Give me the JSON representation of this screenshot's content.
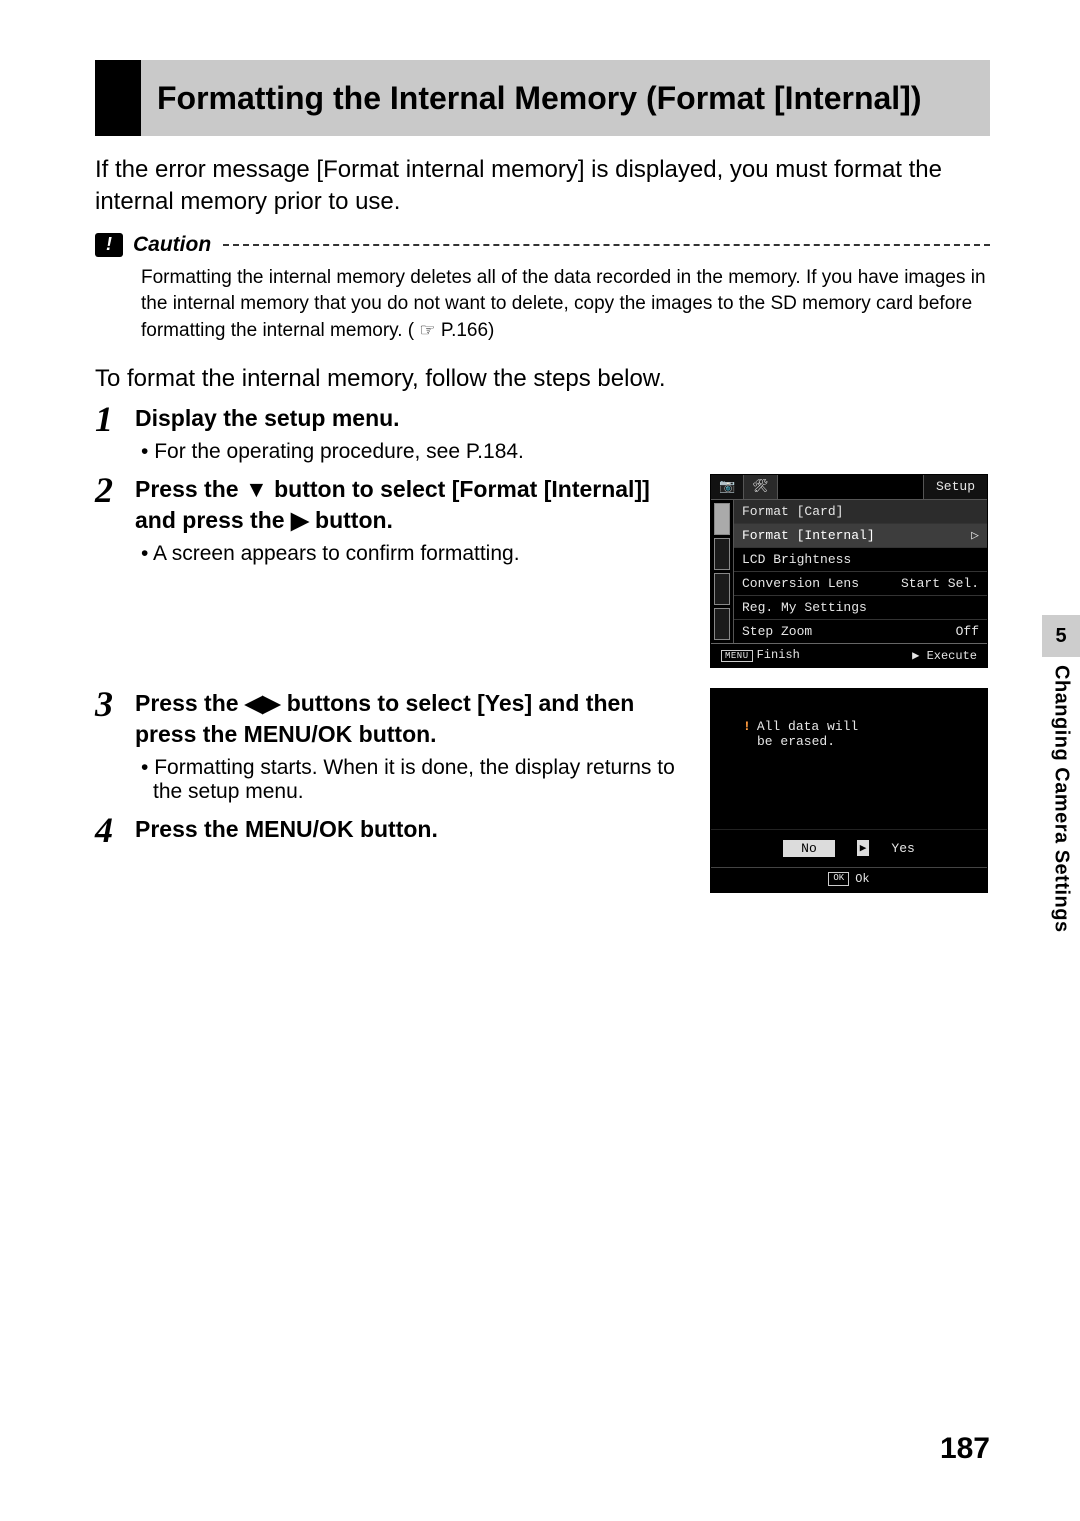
{
  "title": "Formatting the Internal Memory (Format [Internal])",
  "intro": "If the error message [Format internal memory] is displayed, you must format the internal memory prior to use.",
  "caution": {
    "label": "Caution",
    "body_before_ref": "Formatting the internal memory deletes all of the data recorded in the memory. If you have images in the internal memory that you do not want to delete, copy the images to the SD memory card before formatting the internal memory. (",
    "ref": "P.166",
    "body_after_ref": ")"
  },
  "followup": "To format the internal memory, follow the steps below.",
  "steps": {
    "s1": {
      "num": "1",
      "title": "Display the setup menu.",
      "note": "For the operating procedure, see P.184."
    },
    "s2": {
      "num": "2",
      "title_a": "Press the ",
      "title_b_sym": "▼",
      "title_c": " button to select [Format [Internal]] and press the ",
      "title_d_sym": "▶",
      "title_e": " button.",
      "note": "A screen appears to confirm formatting."
    },
    "s3": {
      "num": "3",
      "title_a": "Press the ",
      "title_b_sym": "◀▶",
      "title_c": " buttons to select [Yes] and then press the MENU/OK button.",
      "note": "Formatting starts. When it is done, the display returns to the setup menu."
    },
    "s4": {
      "num": "4",
      "title": "Press the MENU/OK button."
    }
  },
  "lcd1": {
    "tab_camera": "📷",
    "tab_tools": "🛠",
    "tab_setup": "Setup",
    "rows": [
      {
        "label": "Format [Card]",
        "value": ""
      },
      {
        "label": "Format [Internal]",
        "value": "▷"
      },
      {
        "label": "LCD Brightness",
        "value": ""
      },
      {
        "label": "Conversion Lens",
        "value": "Start Sel."
      },
      {
        "label": "Reg. My Settings",
        "value": ""
      },
      {
        "label": "Step Zoom",
        "value": "Off"
      }
    ],
    "footer_menu_badge": "MENU",
    "footer_left": "Finish",
    "footer_right_sym": "▶",
    "footer_right": "Execute"
  },
  "lcd2": {
    "bang": "!",
    "msg_l1": "All data will",
    "msg_l2": "be erased.",
    "no": "No",
    "tri": "▶",
    "yes": "Yes",
    "ok_badge": "OK",
    "ok": "Ok"
  },
  "side": {
    "chapter_num": "5",
    "chapter_text": "Changing Camera Settings"
  },
  "page_number": "187"
}
